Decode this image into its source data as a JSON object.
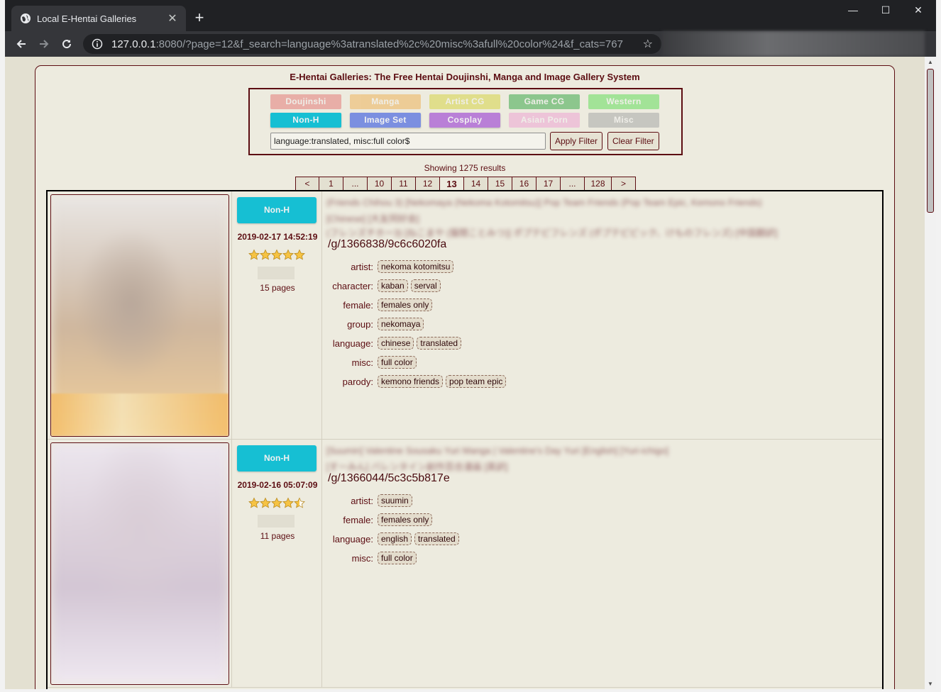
{
  "browser": {
    "tab_title": "Local E-Hentai Galleries",
    "tab_close": "✕",
    "new_tab": "+",
    "url_host": "127.0.0.1",
    "url_rest": ":8080/?page=12&f_search=language%3atranslated%2c%20misc%3afull%20color%24&f_cats=767",
    "window_controls": [
      "—",
      "☐",
      "✕"
    ]
  },
  "page": {
    "site_title": "E-Hentai Galleries: The Free Hentai Doujinshi, Manga and Image Gallery System",
    "categories": [
      {
        "label": "Doujinshi",
        "color": "#e47e7a",
        "active": false
      },
      {
        "label": "Manga",
        "color": "#eeb45c",
        "active": false
      },
      {
        "label": "Artist CG",
        "color": "#d7d547",
        "active": false
      },
      {
        "label": "Game CG",
        "color": "#3da84b",
        "active": false
      },
      {
        "label": "Western",
        "color": "#66dd5d",
        "active": false
      },
      {
        "label": "Non-H",
        "color": "#16bfd3",
        "active": true
      },
      {
        "label": "Image Set",
        "color": "#7b8fe0",
        "active": true
      },
      {
        "label": "Cosplay",
        "color": "#b97fd7",
        "active": true
      },
      {
        "label": "Asian Porn",
        "color": "#eda6d4",
        "active": false
      },
      {
        "label": "Misc",
        "color": "#a8a8a8",
        "active": false
      }
    ],
    "search_value": "language:translated, misc:full color$",
    "apply_filter": "Apply Filter",
    "clear_filter": "Clear Filter",
    "results_text": "Showing 1275 results",
    "pagination": [
      "<",
      "1",
      "...",
      "10",
      "11",
      "12",
      "13",
      "14",
      "15",
      "16",
      "17",
      "...",
      "128",
      ">"
    ],
    "current_page": "13"
  },
  "galleries": [
    {
      "category": "Non-H",
      "posted": "2019-02-17 14:52:19",
      "rating": 5,
      "pages": "15 pages",
      "blurred_title_line1": "(Friends Chihou 3) [Nekomaya (Nekoma Kotomitsu)] Pop Team Friends (Pop Team Epic, Kemono Friends)",
      "blurred_title_line2": "[Chinese] [大友同好会]",
      "blurred_title_line3": "(フレンズチホー3) [ねこまや (猫間ことみつ)] ポプテピフレンズ (ポプテピピック、けものフレンズ) [中国翻訳]",
      "path": "/g/1366838/9c6c6020fa",
      "tags": [
        {
          "ns": "artist:",
          "values": [
            "nekoma kotomitsu"
          ]
        },
        {
          "ns": "character:",
          "values": [
            "kaban",
            "serval"
          ]
        },
        {
          "ns": "female:",
          "values": [
            "females only"
          ]
        },
        {
          "ns": "group:",
          "values": [
            "nekomaya"
          ]
        },
        {
          "ns": "language:",
          "values": [
            "chinese",
            "translated"
          ]
        },
        {
          "ns": "misc:",
          "values": [
            "full color"
          ]
        },
        {
          "ns": "parody:",
          "values": [
            "kemono friends",
            "pop team epic"
          ]
        }
      ]
    },
    {
      "category": "Non-H",
      "posted": "2019-02-16 05:07:09",
      "rating": 4.5,
      "pages": "11 pages",
      "blurred_title_line1": "[Suumin] Valentine Sousaku Yuri Manga | Valentine's Day Yuri [English] [Yuri-ichigo]",
      "blurred_title_line2": "[すーみん] バレンタイン創作百合漫画 [英訳]",
      "path": "/g/1366044/5c3c5b817e",
      "tags": [
        {
          "ns": "artist:",
          "values": [
            "suumin"
          ]
        },
        {
          "ns": "female:",
          "values": [
            "females only"
          ]
        },
        {
          "ns": "language:",
          "values": [
            "english",
            "translated"
          ]
        },
        {
          "ns": "misc:",
          "values": [
            "full color"
          ]
        }
      ]
    }
  ]
}
